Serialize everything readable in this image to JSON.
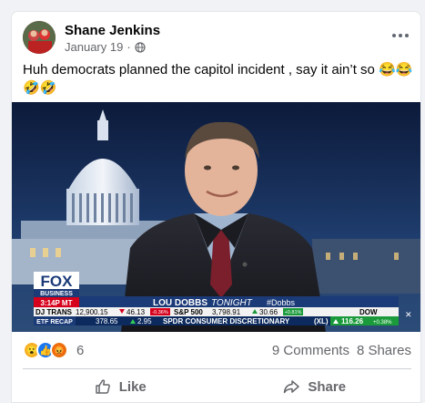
{
  "post": {
    "author": "Shane Jenkins",
    "date": "January 19",
    "separator": "·",
    "text": "Huh democrats planned the capitol incident , say it ain’t so 😂😂🤣🤣",
    "privacy_icon": "globe-icon",
    "menu_icon": "more-options-icon"
  },
  "tv": {
    "network_line1": "FOX",
    "network_line2": "BUSINESS",
    "time": "3:14P MT",
    "show_name": "LOU DOBBS",
    "show_suffix": "TONIGHT",
    "hashtag": "#Dobbs",
    "close": "✕",
    "ticker_row1": [
      {
        "label": "DJ TRANS",
        "value": "12,900.15",
        "change": "46.13",
        "pct": "-0.36%",
        "dir": "down"
      },
      {
        "label": "S&P 500",
        "value": "3,798.91",
        "change": "30.66",
        "pct": "+0.81%",
        "dir": "up"
      },
      {
        "label": "DOW",
        "value": "",
        "change": "",
        "pct": "",
        "dir": "none"
      }
    ],
    "ticker_row2": [
      {
        "label": "ETF RECAP",
        "value": "378.65",
        "change": "2.95",
        "dir": "up"
      },
      {
        "label": "SPDR CONSUMER DISCRETIONARY",
        "suffix": "(XL)",
        "dir": "none"
      },
      {
        "label": "",
        "value": "116.26",
        "pct": "+0.38%",
        "dir": "up"
      }
    ]
  },
  "reactions": {
    "icons": [
      "haha-reaction",
      "like-reaction",
      "angry-reaction"
    ],
    "emoji": [
      "😮",
      "👍",
      "😡"
    ],
    "count": "6",
    "comments": "9 Comments",
    "shares": "8 Shares"
  },
  "actions": {
    "like": "Like",
    "share": "Share"
  },
  "colors": {
    "fb_gray": "#65676b",
    "like_blue": "#1877f2",
    "fox_red": "#d6001c",
    "ticker_blue": "#1b3a78"
  }
}
